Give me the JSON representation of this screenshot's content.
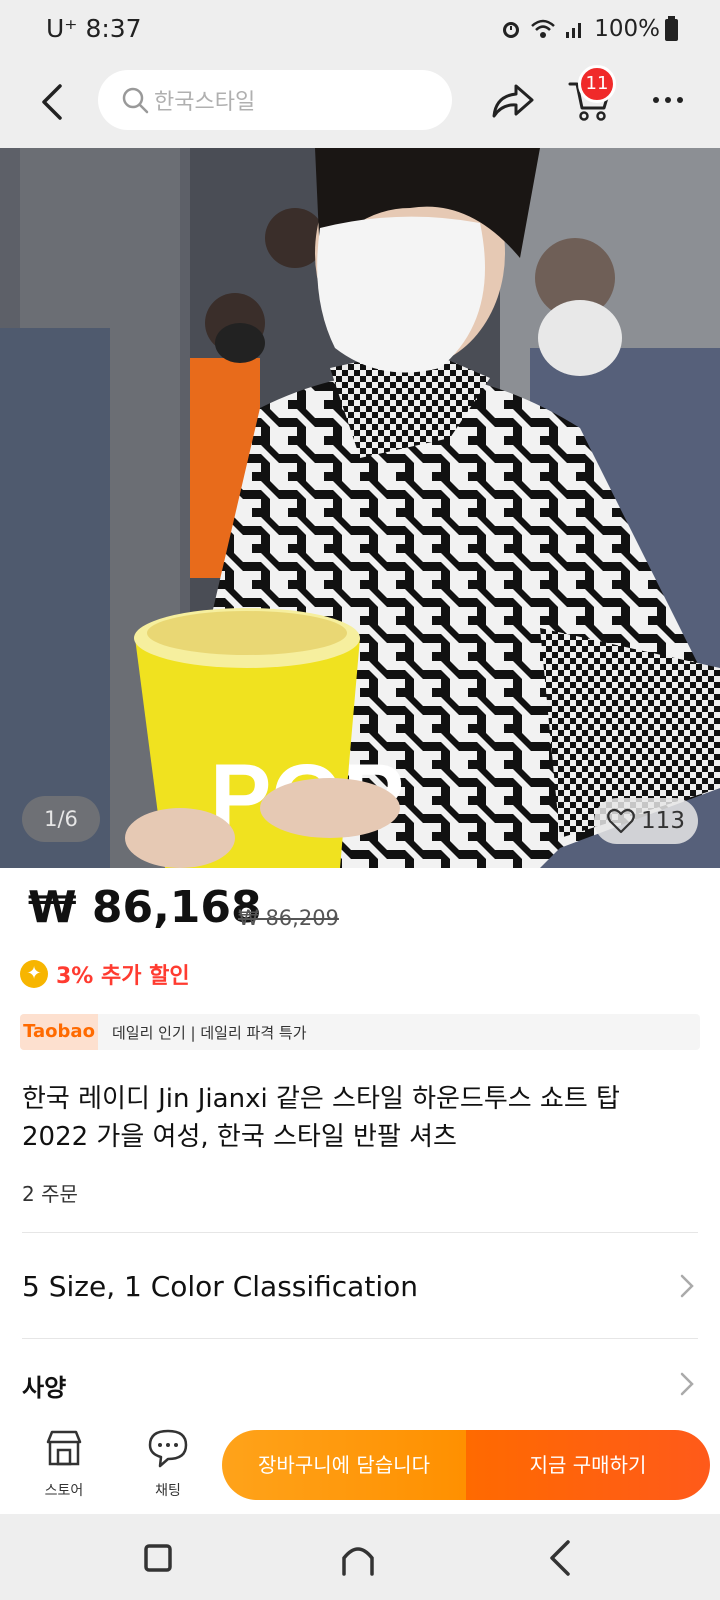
{
  "status_bar": {
    "carrier_time": "U⁺ 8:37",
    "battery": "100%"
  },
  "top_nav": {
    "search_placeholder": "한국스타일",
    "cart_count": "11"
  },
  "gallery": {
    "counter": "1/6",
    "likes": "113",
    "image_text": "POP"
  },
  "product": {
    "price": "₩ 86,168",
    "original_price": "₩ 86,209",
    "discount": "3% 추가 할인",
    "taobao_tag": "Taobao",
    "taobao_text": "데일리 인기 | 데일리 파격 특가",
    "title": "한국 레이디 Jin Jianxi 같은 스타일 하운드투스 쇼트 탑 2022 가을 여성, 한국 스타일 반팔 셔츠",
    "orders": "2 주문"
  },
  "options": {
    "size_color": "5 Size, 1 Color Classification",
    "spec": "사양"
  },
  "action_bar": {
    "store_label": "스토어",
    "chat_label": "채팅",
    "add_to_cart": "장바구니에 담습니다",
    "buy_now": "지금 구매하기"
  },
  "colors": {
    "accent_orange": "#ff9000",
    "accent_red_orange": "#ff5a1a",
    "badge_red": "#f02a2a",
    "discount_red": "#ff3b30"
  }
}
